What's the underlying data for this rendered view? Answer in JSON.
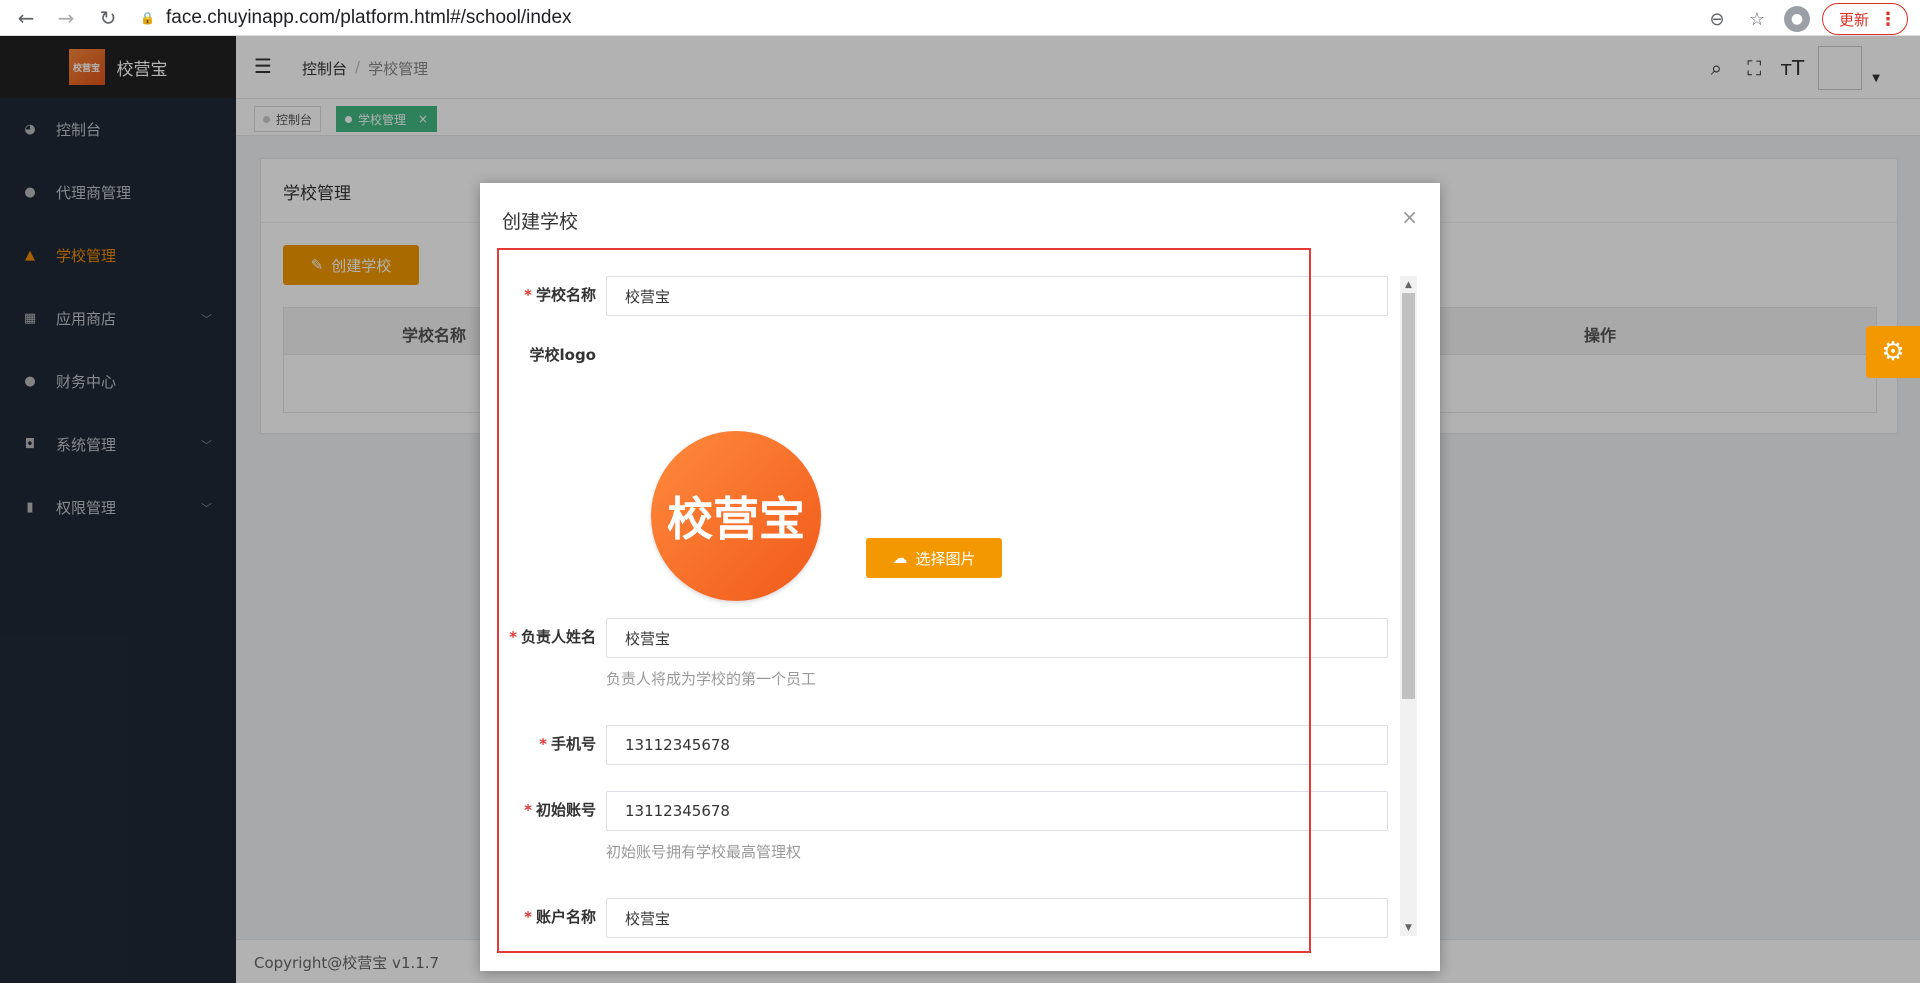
{
  "browser": {
    "url": "face.chuyinapp.com/platform.html#/school/index",
    "update_label": "更新"
  },
  "sidebar": {
    "logo_mark": "校营宝",
    "logo_text": "校营宝",
    "items": [
      {
        "label": "控制台",
        "icon": "dashboard-icon",
        "active": false,
        "has_arrow": false
      },
      {
        "label": "代理商管理",
        "icon": "user-icon",
        "active": false,
        "has_arrow": false
      },
      {
        "label": "学校管理",
        "icon": "school-icon",
        "active": true,
        "has_arrow": false
      },
      {
        "label": "应用商店",
        "icon": "windows-icon",
        "active": false,
        "has_arrow": true
      },
      {
        "label": "财务中心",
        "icon": "coin-icon",
        "active": false,
        "has_arrow": false
      },
      {
        "label": "系统管理",
        "icon": "settings-icon",
        "active": false,
        "has_arrow": true
      },
      {
        "label": "权限管理",
        "icon": "book-icon",
        "active": false,
        "has_arrow": true
      }
    ]
  },
  "topbar": {
    "breadcrumb": [
      "控制台",
      "学校管理"
    ]
  },
  "tags": [
    {
      "label": "控制台",
      "active": false
    },
    {
      "label": "学校管理",
      "active": true,
      "close": "×"
    }
  ],
  "page": {
    "card_title": "学校管理",
    "create_button": "创建学校",
    "columns": [
      "学校名称",
      "操作"
    ]
  },
  "footer": {
    "copyright": "Copyright@校营宝 v1.1.7"
  },
  "modal": {
    "title": "创建学校",
    "close": "×",
    "fields": {
      "school_name": {
        "label": "学校名称",
        "value": "校营宝",
        "required": true
      },
      "school_logo": {
        "label": "学校logo",
        "logo_text": "校营宝",
        "button": "选择图片"
      },
      "owner_name": {
        "label": "负责人姓名",
        "value": "校营宝",
        "hint": "负责人将成为学校的第一个员工",
        "required": true
      },
      "phone": {
        "label": "手机号",
        "value": "13112345678",
        "required": true
      },
      "init_account": {
        "label": "初始账号",
        "value": "13112345678",
        "hint": "初始账号拥有学校最高管理权",
        "required": true
      },
      "account_name": {
        "label": "账户名称",
        "value": "校营宝",
        "required": true
      }
    }
  },
  "colors": {
    "accent": "#f39800",
    "tag_active": "#42b983",
    "sidebar_bg": "#1f2937",
    "highlight_frame": "#e53935"
  }
}
